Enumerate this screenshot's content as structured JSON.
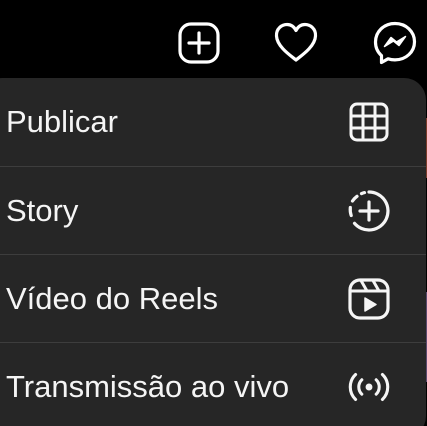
{
  "topbar": {
    "icons": [
      "plus-square-icon",
      "heart-icon",
      "messenger-icon"
    ]
  },
  "create_menu": {
    "items": [
      {
        "label": "Publicar",
        "icon": "grid-icon"
      },
      {
        "label": "Story",
        "icon": "story-add-icon"
      },
      {
        "label": "Vídeo do Reels",
        "icon": "reels-icon"
      },
      {
        "label": "Transmissão ao vivo",
        "icon": "live-broadcast-icon"
      }
    ]
  },
  "colors": {
    "background": "#000000",
    "menu_background": "#262626",
    "text": "#f5f5f5",
    "divider": "#3d3d3d"
  }
}
